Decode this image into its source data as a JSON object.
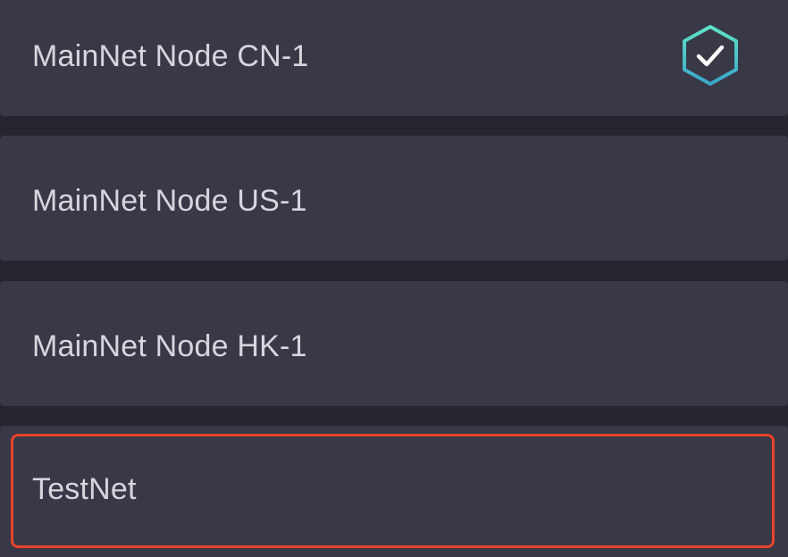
{
  "node_list": {
    "items": [
      {
        "label": "MainNet Node CN-1",
        "selected": true
      },
      {
        "label": "MainNet Node US-1",
        "selected": false
      },
      {
        "label": "MainNet Node HK-1",
        "selected": false
      },
      {
        "label": "TestNet",
        "selected": false
      }
    ]
  },
  "selected_icon": "hexagon-check-icon",
  "colors": {
    "background": "#25252f",
    "item_background": "#383846",
    "text": "#d6d6de",
    "check_accent": "#4fd6c3",
    "highlight": "#e8432a"
  }
}
